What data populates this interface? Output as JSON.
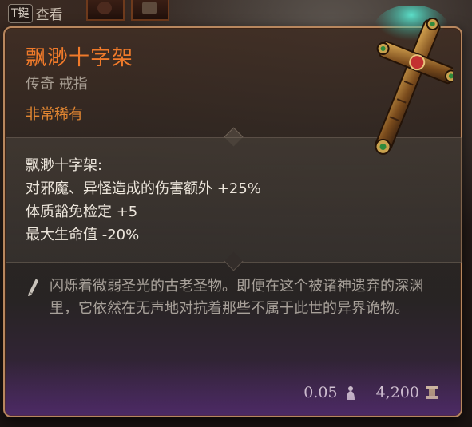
{
  "hotkey": {
    "key": "T键",
    "label": "查看"
  },
  "item": {
    "name": "飘渺十字架",
    "type": "传奇 戒指",
    "rarity": "非常稀有",
    "stats_title": "飘渺十字架:",
    "stats": [
      "对邪魔、异怪造成的伤害额外 +25%",
      "体质豁免检定 +5",
      "最大生命值 -20%"
    ],
    "flavor": "闪烁着微弱圣光的古老圣物。即便在这个被诸神遗弃的深渊里，它依然在无声地对抗着那些不属于此世的异界诡物。"
  },
  "footer": {
    "weight": "0.05",
    "price": "4,200"
  },
  "icons": {
    "weight": "weight-icon",
    "price": "gold-icon",
    "flavor": "quill-icon",
    "item": "cross-relic-icon"
  },
  "colors": {
    "name": "#f07a2a",
    "rarity": "#e38732",
    "border": "#b8875e"
  }
}
